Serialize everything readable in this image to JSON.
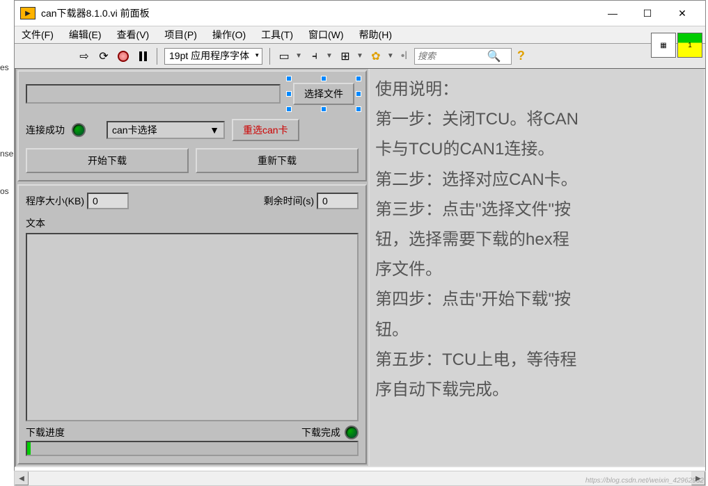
{
  "title": "can下载器8.1.0.vi 前面板",
  "menu": [
    "文件(F)",
    "编辑(E)",
    "查看(V)",
    "项目(P)",
    "操作(O)",
    "工具(T)",
    "窗口(W)",
    "帮助(H)"
  ],
  "toolbar": {
    "font": "19pt 应用程序字体",
    "search_placeholder": "搜索"
  },
  "left_truncated": {
    "a": "es",
    "b": "nse",
    "c": "os"
  },
  "panel1": {
    "select_file": "选择文件",
    "connect_ok": "连接成功",
    "can_select": "can卡选择",
    "rechoose": "重选can卡",
    "start_dl": "开始下载",
    "restart_dl": "重新下载"
  },
  "panel2": {
    "size_label": "程序大小(KB)",
    "size_val": "0",
    "time_label": "剩余时间(s)",
    "time_val": "0",
    "text_label": "文本",
    "progress_label": "下载进度",
    "done_label": "下载完成"
  },
  "instructions": {
    "title": "使用说明：",
    "s1a": "第一步：关闭TCU。将CAN",
    "s1b": "卡与TCU的CAN1连接。",
    "s2": "第二步：选择对应CAN卡。",
    "s3a": "第三步：点击\"选择文件\"按",
    "s3b": "钮，选择需要下载的hex程",
    "s3c": "序文件。",
    "s4a": "第四步：点击\"开始下载\"按",
    "s4b": "钮。",
    "s5a": "第五步：TCU上电，等待程",
    "s5b": "序自动下载完成。"
  },
  "watermark": "https://blog.csdn.net/weixin_42962932"
}
